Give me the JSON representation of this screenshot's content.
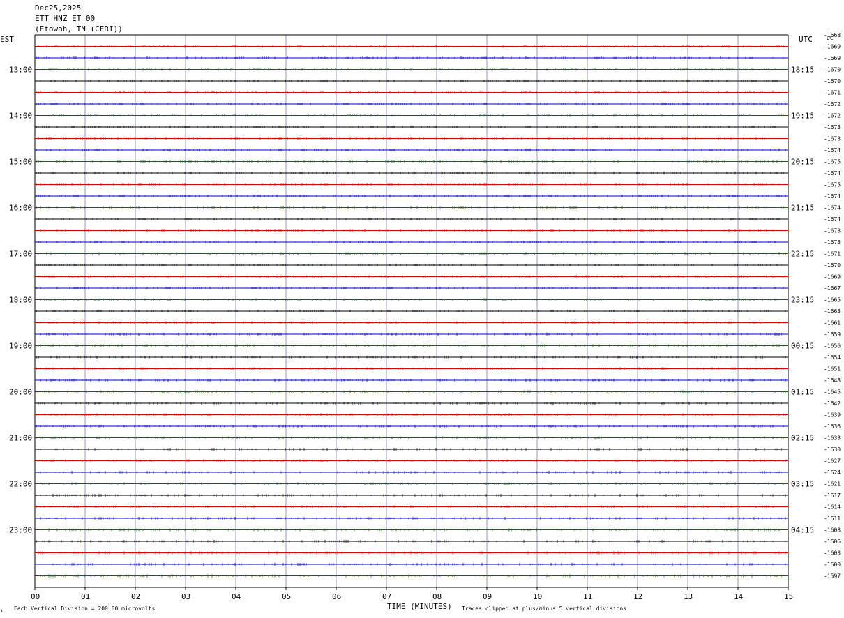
{
  "header": {
    "date": "Dec25,2025",
    "station": "ETT HNZ ET 00",
    "location": "(Etowah, TN (CERI))"
  },
  "left_zone": "EST",
  "right_zone": "UTC",
  "dc_header": "DC",
  "footer": {
    "division_note": "Each Vertical Division =  200.00 microvolts",
    "xlabel": "TIME (MINUTES)",
    "clip_note": "Traces clipped at plus/minus 5 vertical divisions",
    "corner_mark": "↕"
  },
  "chart_data": {
    "type": "line",
    "title": "Dec25,2025",
    "xlabel": "TIME (MINUTES)",
    "ylabel": "",
    "xlim": [
      0,
      15
    ],
    "x_ticks": [
      "00",
      "01",
      "02",
      "03",
      "04",
      "05",
      "06",
      "07",
      "08",
      "09",
      "10",
      "11",
      "12",
      "13",
      "14",
      "15"
    ],
    "est_labels": [
      "13:00",
      "14:00",
      "15:00",
      "16:00",
      "17:00",
      "18:00",
      "19:00",
      "20:00",
      "21:00",
      "22:00",
      "23:00"
    ],
    "utc_labels": [
      "18:15",
      "19:15",
      "20:15",
      "21:15",
      "22:15",
      "23:15",
      "00:15",
      "01:15",
      "02:15",
      "03:15",
      "04:15"
    ],
    "dc_offsets": [
      -1668,
      -1669,
      -1669,
      -1670,
      -1670,
      -1671,
      -1672,
      -1672,
      -1673,
      -1673,
      -1674,
      -1675,
      -1674,
      -1675,
      -1674,
      -1674,
      -1674,
      -1673,
      -1673,
      -1671,
      -1670,
      -1669,
      -1667,
      -1665,
      -1663,
      -1661,
      -1659,
      -1656,
      -1654,
      -1651,
      -1648,
      -1645,
      -1642,
      -1639,
      -1636,
      -1633,
      -1630,
      -1627,
      -1624,
      -1621,
      -1617,
      -1614,
      -1611,
      -1608,
      -1606,
      -1603,
      -1600,
      -1597
    ],
    "trace_colors": [
      "#000000",
      "#e00000",
      "#0000d0",
      "#006e00"
    ],
    "grid_colors": {
      "minute_line": "#9999cc"
    },
    "traces_per_hour": 4,
    "minutes_per_trace": 15,
    "vertical_division_microvolts": 200.0,
    "clip_divisions": 5
  }
}
